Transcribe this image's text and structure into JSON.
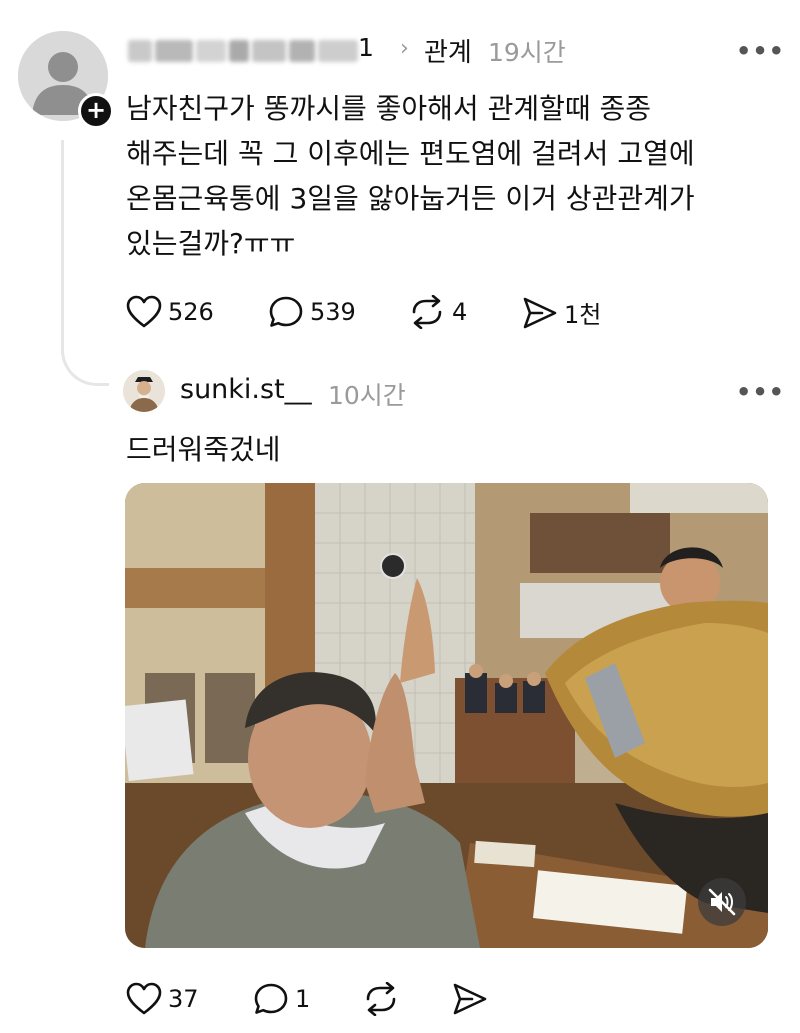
{
  "post": {
    "username_visible_tail": "1",
    "chevron": "›",
    "topic": "관계",
    "time": "19시간",
    "more_label": "•••",
    "follow_badge": "+",
    "text_lines": [
      "남자친구가 똥까시를 좋아해서 관계할때 종종",
      "해주는데 꼭 그 이후에는 편도염에 걸려서 고열에",
      "온몸근육통에 3일을 앓아눕거든 이거 상관관계가",
      "있는걸까?ㅠㅠ"
    ],
    "likes": "526",
    "comments": "539",
    "reposts": "4",
    "shares": "1천"
  },
  "reply": {
    "username": "sunki.st__",
    "time": "10시간",
    "more_label": "•••",
    "text": "드러워죽겄네",
    "likes": "37",
    "comments": "1"
  },
  "icons": {
    "like": "heart-icon",
    "comment": "speech-bubble-icon",
    "repost": "repost-arrows-icon",
    "share": "send-icon",
    "mute": "speaker-muted-icon"
  },
  "colors": {
    "text": "#111111",
    "muted": "#9a9a9a",
    "thread_line": "#e6e6e6"
  }
}
